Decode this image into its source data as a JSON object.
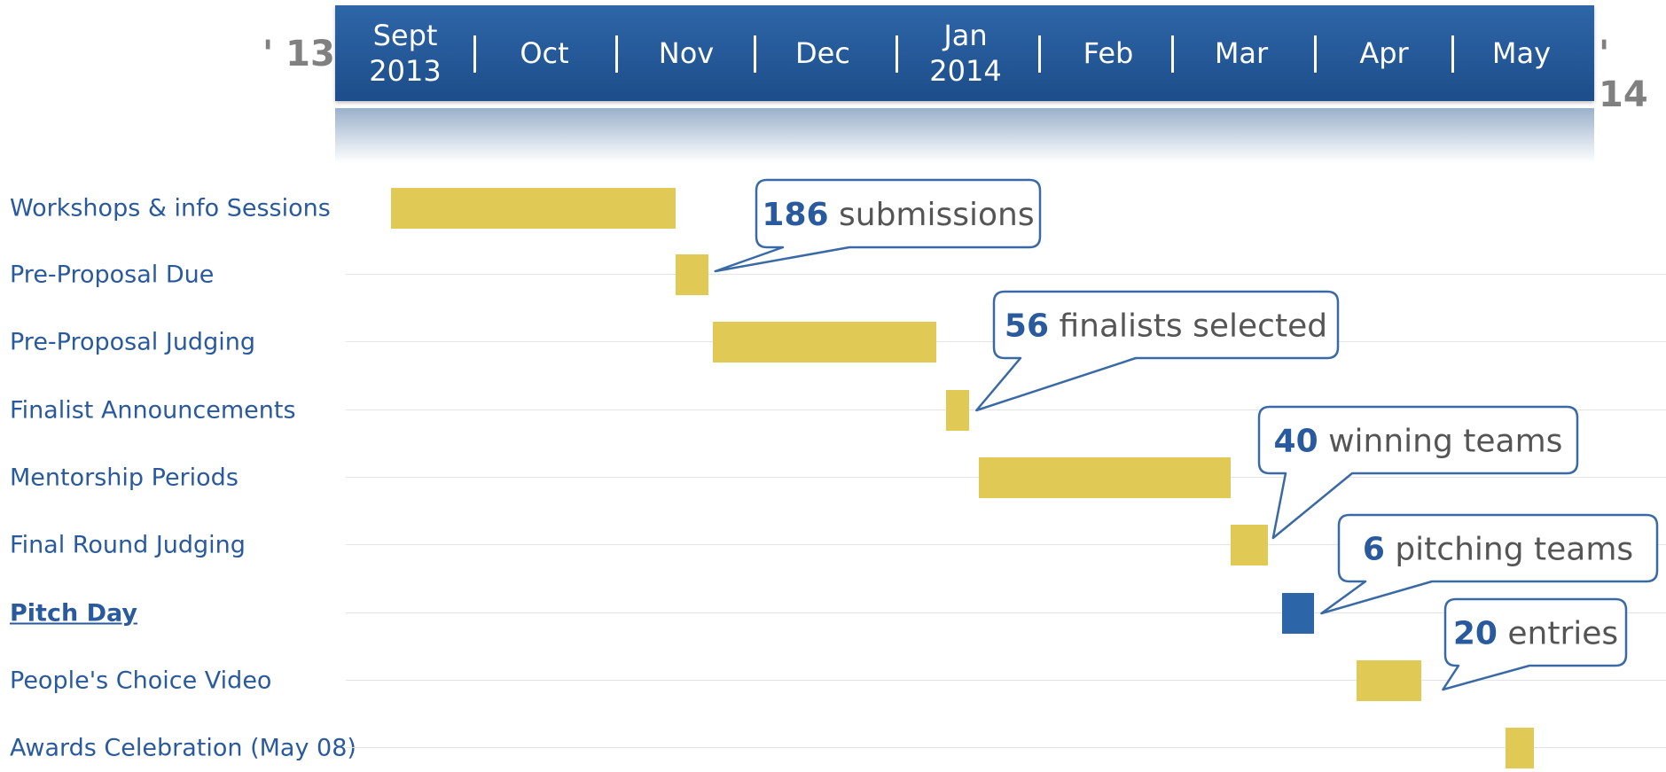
{
  "timeline": {
    "year_start": "' 13",
    "year_end": "' 14",
    "months": [
      {
        "line1": "Sept",
        "line2": "2013"
      },
      {
        "line1": "Oct",
        "line2": ""
      },
      {
        "line1": "Nov",
        "line2": ""
      },
      {
        "line1": "Dec",
        "line2": ""
      },
      {
        "line1": "Jan",
        "line2": "2014"
      },
      {
        "line1": "Feb",
        "line2": ""
      },
      {
        "line1": "Mar",
        "line2": ""
      },
      {
        "line1": "Apr",
        "line2": ""
      },
      {
        "line1": "May",
        "line2": ""
      }
    ]
  },
  "chart_data": {
    "type": "gantt",
    "title": "",
    "x_axis": "months Sept 2013 – May 2014",
    "tasks": [
      {
        "name": "Workshops & info Sessions",
        "start": "2013-09-06",
        "end": "2013-11-06",
        "highlight": false
      },
      {
        "name": "Pre-Proposal Due",
        "start": "2013-11-06",
        "end": "2013-11-13",
        "highlight": false
      },
      {
        "name": "Pre-Proposal Judging",
        "start": "2013-11-14",
        "end": "2014-01-01",
        "highlight": false
      },
      {
        "name": "Finalist Announcements",
        "start": "2014-01-03",
        "end": "2014-01-08",
        "highlight": false
      },
      {
        "name": "Mentorship Periods",
        "start": "2014-01-10",
        "end": "2014-03-05",
        "highlight": false
      },
      {
        "name": "Final Round Judging",
        "start": "2014-03-05",
        "end": "2014-03-13",
        "highlight": false
      },
      {
        "name": "Pitch Day",
        "start": "2014-03-16",
        "end": "2014-03-23",
        "highlight": true
      },
      {
        "name": "People's Choice Video",
        "start": "2014-04-01",
        "end": "2014-04-15",
        "highlight": false
      },
      {
        "name": "Awards Celebration (May 08)",
        "start": "2014-05-03",
        "end": "2014-05-09",
        "highlight": false
      }
    ],
    "callouts": [
      {
        "task": "Pre-Proposal Due",
        "number": "186",
        "text": " submissions"
      },
      {
        "task": "Finalist Announcements",
        "number": "56",
        "text": " finalists selected"
      },
      {
        "task": "Final Round Judging",
        "number": "40",
        "text": " winning teams"
      },
      {
        "task": "Pitch Day",
        "number": "6",
        "text": " pitching teams"
      },
      {
        "task": "People's Choice Video",
        "number": "20",
        "text": " entries"
      }
    ]
  },
  "colors": {
    "bar": "#e0c955",
    "highlight_bar": "#2d66a8",
    "header": "#2a5c9e",
    "label": "#2a5a9e",
    "callout_border": "#3a6aa5",
    "year_text": "#808080"
  }
}
